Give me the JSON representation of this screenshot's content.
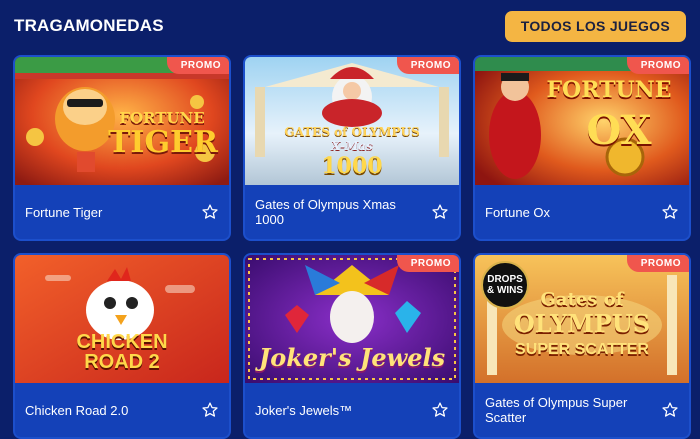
{
  "header": {
    "title": "TRAGAMONEDAS",
    "all_games_label": "TODOS LOS JUEGOS"
  },
  "colors": {
    "background": "#0b1f6a",
    "card": "#1441b8",
    "accent_button": "#f4b543",
    "promo_badge": "#f0564d"
  },
  "games": [
    {
      "name": "Fortune Tiger",
      "promo": "PROMO",
      "art_title_1": "FORTUNE",
      "art_title_2": "TIGER",
      "favorite_icon": "star-outline-icon"
    },
    {
      "name": "Gates of Olympus Xmas 1000",
      "promo": "PROMO",
      "art_title_1": "GATES of OLYMPUS",
      "art_title_2": "X-Mas",
      "art_title_3": "1000",
      "favorite_icon": "star-outline-icon"
    },
    {
      "name": "Fortune Ox",
      "promo": "PROMO",
      "art_title_1": "FORTUNE",
      "art_title_2": "OX",
      "favorite_icon": "star-outline-icon"
    },
    {
      "name": "Chicken Road 2.0",
      "promo": "",
      "art_title_1": "CHICKEN",
      "art_title_2": "ROAD 2",
      "favorite_icon": "star-outline-icon"
    },
    {
      "name": "Joker's Jewels™",
      "promo": "PROMO",
      "art_title_1": "Joker's Jewels",
      "favorite_icon": "star-outline-icon"
    },
    {
      "name": "Gates of Olympus Super Scatter",
      "promo": "PROMO",
      "art_title_1": "Gates of",
      "art_title_2": "OLYMPUS",
      "art_title_3": "SUPER SCATTER",
      "drops_badge": "DROPS & WINS",
      "favorite_icon": "star-outline-icon"
    }
  ]
}
